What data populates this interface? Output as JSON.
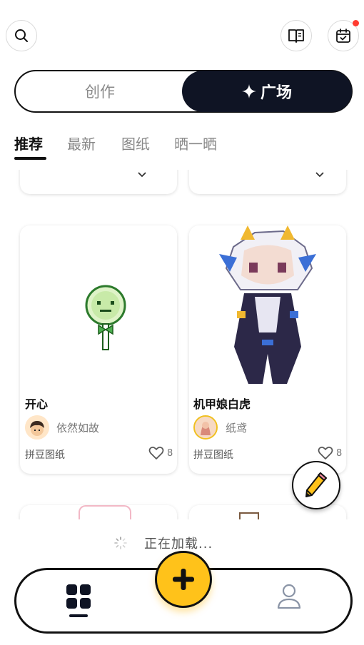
{
  "header": {
    "search_icon": "search-icon",
    "book_icon": "book-open-icon",
    "calendar_icon": "calendar-check-icon",
    "notification_dot_color": "#ff3b30"
  },
  "segment": {
    "left_label": "创作",
    "right_label": "广场",
    "right_icon": "sparkle-icon"
  },
  "tabs": [
    {
      "label": "推荐",
      "active": true
    },
    {
      "label": "最新",
      "active": false
    },
    {
      "label": "图纸",
      "active": false
    },
    {
      "label": "晒一晒",
      "active": false
    }
  ],
  "cards": [
    {
      "title": "开心",
      "author": "依然如故",
      "tag": "拼豆图纸",
      "likes": "8"
    },
    {
      "title": "机甲娘白虎",
      "author": "纸鸢",
      "tag": "拼豆图纸",
      "likes": "8"
    }
  ],
  "loading": {
    "text": "正在加载..."
  },
  "nav": {
    "home_icon": "grid-icon",
    "add_icon": "plus-icon",
    "profile_icon": "user-icon"
  },
  "colors": {
    "accent": "#ffc21a",
    "dark": "#0f1424"
  }
}
